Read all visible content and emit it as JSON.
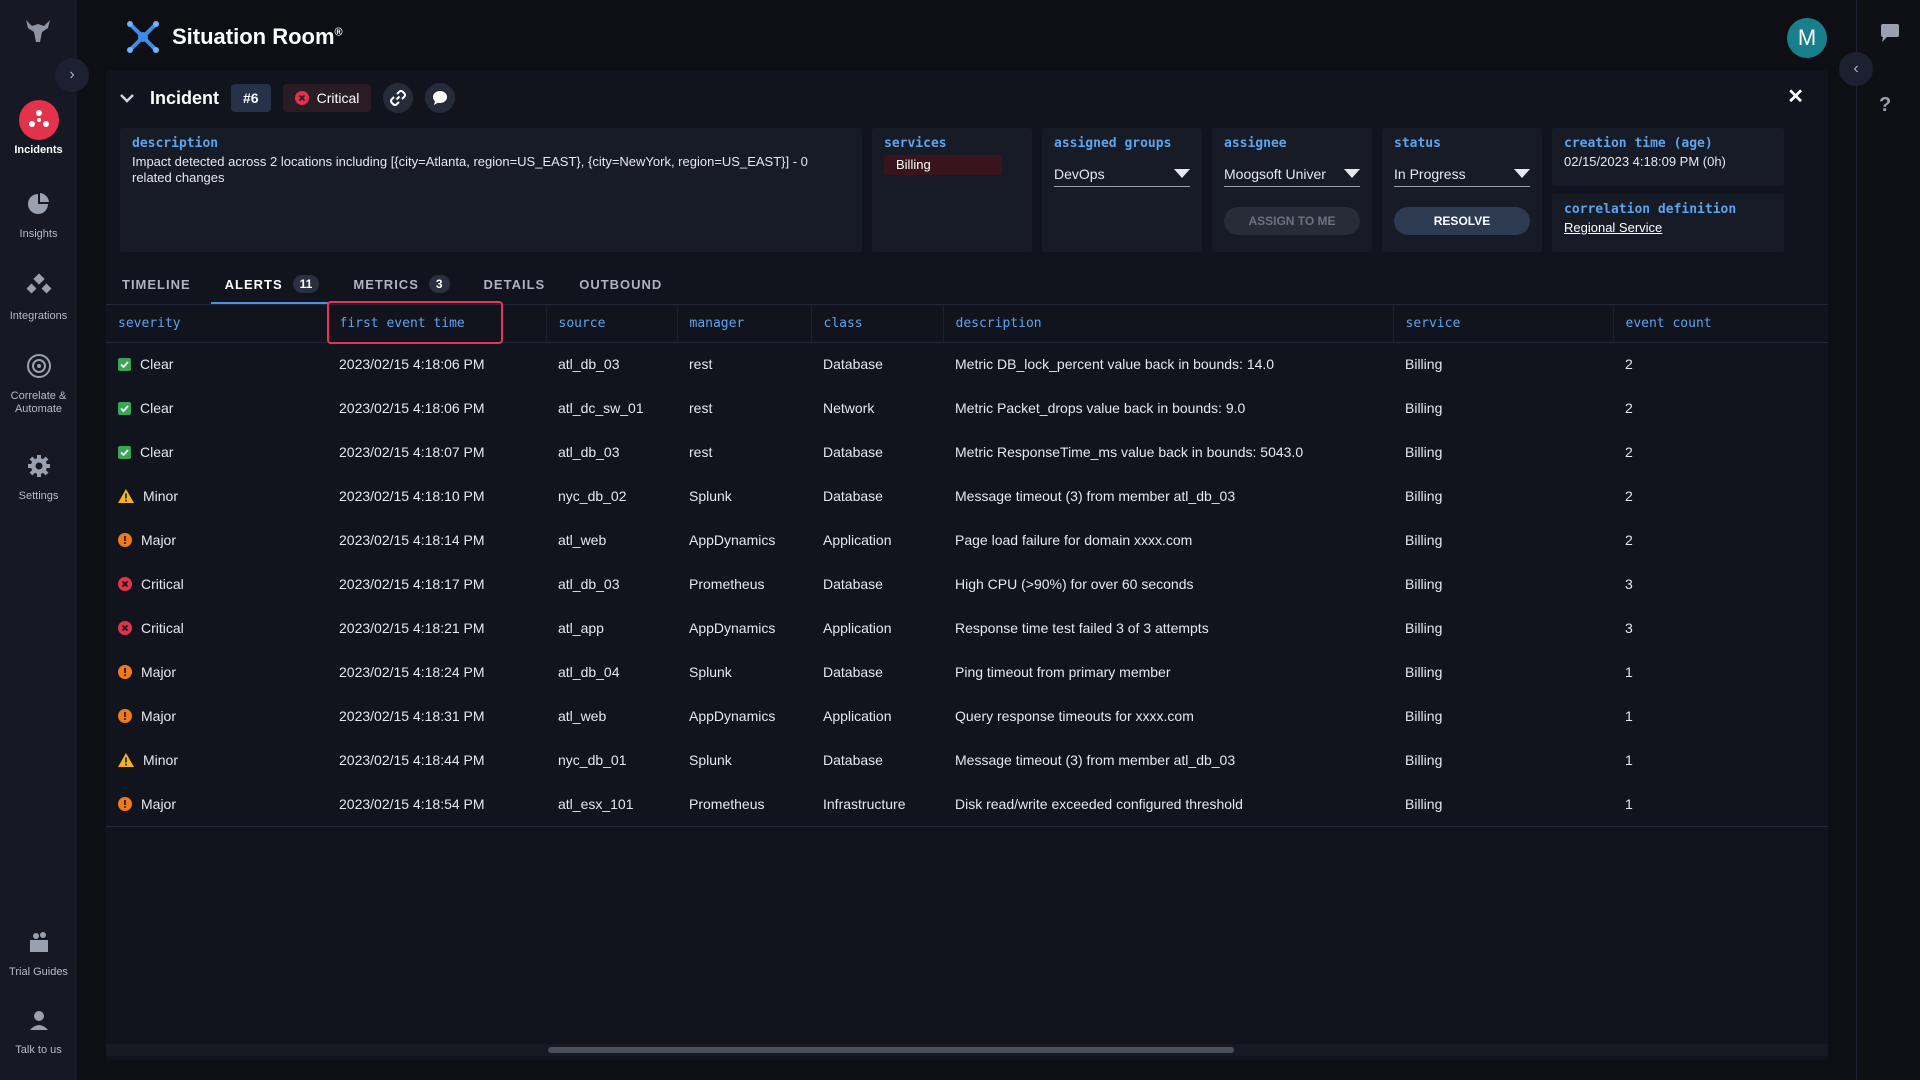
{
  "app": {
    "title": "Situation Room",
    "reg": "®"
  },
  "user": {
    "avatar_initial": "M"
  },
  "nav": {
    "items": [
      {
        "label": "Incidents",
        "icon": "incidents-icon",
        "active": true
      },
      {
        "label": "Insights",
        "icon": "insights-icon"
      },
      {
        "label": "Integrations",
        "icon": "integrations-icon"
      },
      {
        "label": "Correlate &",
        "label2": "Automate",
        "icon": "correlate-icon"
      },
      {
        "label": "Settings",
        "icon": "gear-icon"
      },
      {
        "label": "Trial Guides",
        "icon": "trial-guides-icon"
      },
      {
        "label": "Talk to us",
        "icon": "talk-icon"
      }
    ]
  },
  "incident": {
    "title": "Incident",
    "number": "#6",
    "severity": "Critical",
    "description_label": "description",
    "description": "Impact detected across 2 locations including [{city=Atlanta, region=US_EAST}, {city=NewYork, region=US_EAST}] - 0 related changes",
    "services_label": "services",
    "service": "Billing",
    "groups_label": "assigned groups",
    "group": "DevOps",
    "assignee_label": "assignee",
    "assignee": "Moogsoft Univer",
    "assign_button": "ASSIGN TO ME",
    "status_label": "status",
    "status": "In Progress",
    "resolve_button": "RESOLVE",
    "creation_label": "creation time (age)",
    "creation": "02/15/2023 4:18:09 PM (0h)",
    "correlation_label": "correlation definition",
    "correlation": "Regional Service"
  },
  "tabs": [
    {
      "label": "TIMELINE"
    },
    {
      "label": "ALERTS",
      "count": "11",
      "active": true
    },
    {
      "label": "METRICS",
      "count": "3"
    },
    {
      "label": "DETAILS"
    },
    {
      "label": "OUTBOUND"
    }
  ],
  "table": {
    "columns": [
      "severity",
      "first event time",
      "source",
      "manager",
      "class",
      "description",
      "service",
      "event count"
    ],
    "rows": [
      [
        "Clear",
        "2023/02/15 4:18:06 PM",
        "atl_db_03",
        "rest",
        "Database",
        "Metric DB_lock_percent value back in bounds: 14.0",
        "Billing",
        "2"
      ],
      [
        "Clear",
        "2023/02/15 4:18:06 PM",
        "atl_dc_sw_01",
        "rest",
        "Network",
        "Metric Packet_drops value back in bounds: 9.0",
        "Billing",
        "2"
      ],
      [
        "Clear",
        "2023/02/15 4:18:07 PM",
        "atl_db_03",
        "rest",
        "Database",
        "Metric ResponseTime_ms value back in bounds: 5043.0",
        "Billing",
        "2"
      ],
      [
        "Minor",
        "2023/02/15 4:18:10 PM",
        "nyc_db_02",
        "Splunk",
        "Database",
        "Message timeout (3) from member atl_db_03",
        "Billing",
        "2"
      ],
      [
        "Major",
        "2023/02/15 4:18:14 PM",
        "atl_web",
        "AppDynamics",
        "Application",
        "Page load failure for domain xxxx.com",
        "Billing",
        "2"
      ],
      [
        "Critical",
        "2023/02/15 4:18:17 PM",
        "atl_db_03",
        "Prometheus",
        "Database",
        "High CPU (>90%) for over 60 seconds",
        "Billing",
        "3"
      ],
      [
        "Critical",
        "2023/02/15 4:18:21 PM",
        "atl_app",
        "AppDynamics",
        "Application",
        "Response time test failed 3 of 3 attempts",
        "Billing",
        "3"
      ],
      [
        "Major",
        "2023/02/15 4:18:24 PM",
        "atl_db_04",
        "Splunk",
        "Database",
        "Ping timeout from primary member",
        "Billing",
        "1"
      ],
      [
        "Major",
        "2023/02/15 4:18:31 PM",
        "atl_web",
        "AppDynamics",
        "Application",
        "Query response timeouts for xxxx.com",
        "Billing",
        "1"
      ],
      [
        "Minor",
        "2023/02/15 4:18:44 PM",
        "nyc_db_01",
        "Splunk",
        "Database",
        "Message timeout (3) from member atl_db_03",
        "Billing",
        "1"
      ],
      [
        "Major",
        "2023/02/15 4:18:54 PM",
        "atl_esx_101",
        "Prometheus",
        "Infrastructure",
        "Disk read/write exceeded configured threshold",
        "Billing",
        "1"
      ]
    ]
  },
  "colors": {
    "clear": "#3aa655",
    "minor": "#f3b323",
    "major": "#f07a1a",
    "critical": "#e2334a",
    "accent": "#5aa4f0"
  }
}
